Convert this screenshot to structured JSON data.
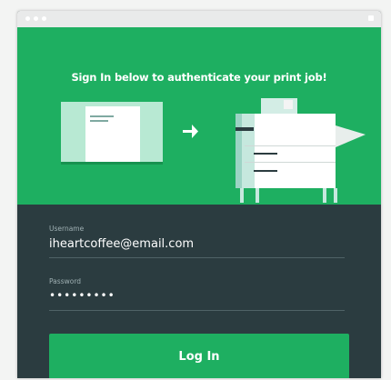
{
  "window": {
    "controls": [
      "window-dot-icon",
      "window-dot-icon",
      "window-dot-icon",
      "close-icon"
    ]
  },
  "hero": {
    "message": "Sign In below to authenticate your print job!",
    "illustration": [
      "document-icon",
      "arrow-right-icon",
      "printer-icon"
    ]
  },
  "form": {
    "username": {
      "label": "Username",
      "value": "iheartcoffee@email.com"
    },
    "password": {
      "label": "Password",
      "value": "•••••••••"
    },
    "login_label": "Log In"
  },
  "colors": {
    "brand_green": "#1eaf61",
    "dark_panel": "#2b3c40",
    "titlebar": "#e9eaea"
  }
}
